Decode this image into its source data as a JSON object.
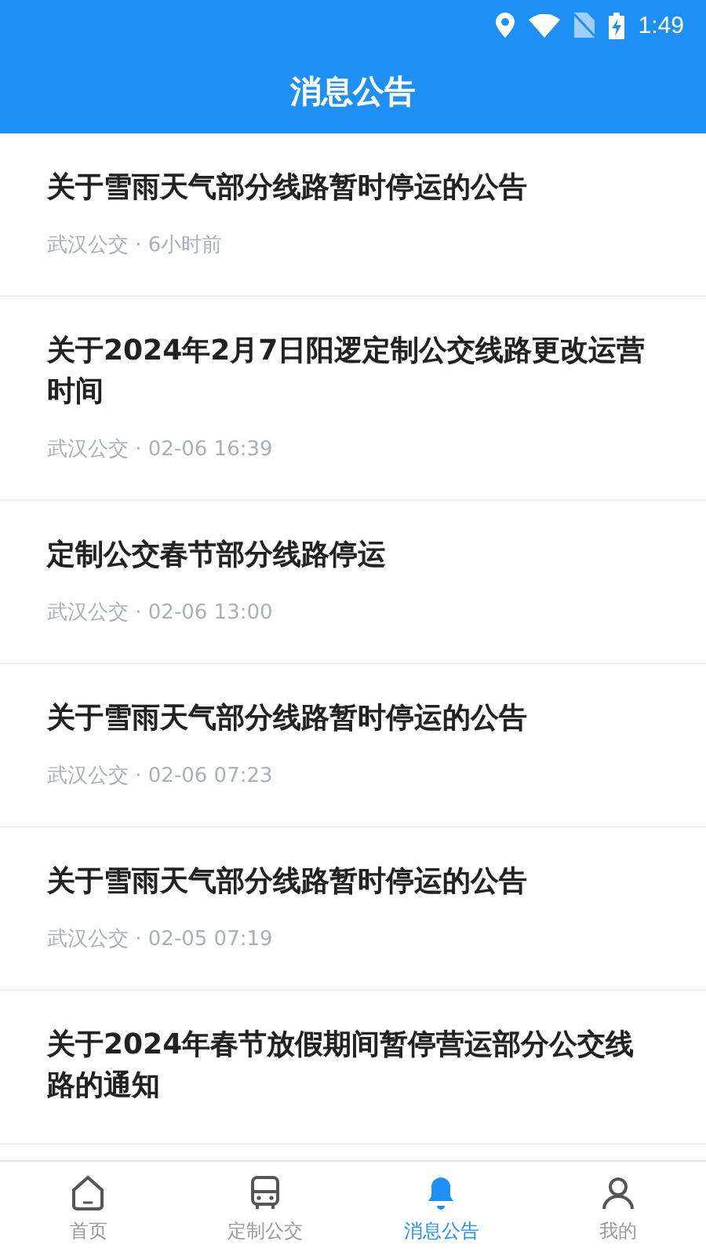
{
  "status_bar": {
    "time": "1:49"
  },
  "header": {
    "title": "消息公告"
  },
  "notices": [
    {
      "title": "关于雪雨天气部分线路暂时停运的公告",
      "meta": "武汉公交 · 6小时前"
    },
    {
      "title": "关于2024年2月7日阳逻定制公交线路更改运营时间",
      "meta": "武汉公交 · 02-06 16:39"
    },
    {
      "title": "定制公交春节部分线路停运",
      "meta": "武汉公交 · 02-06 13:00"
    },
    {
      "title": "关于雪雨天气部分线路暂时停运的公告",
      "meta": "武汉公交 · 02-06 07:23"
    },
    {
      "title": "关于雪雨天气部分线路暂时停运的公告",
      "meta": "武汉公交 · 02-05 07:19"
    },
    {
      "title": "关于2024年春节放假期间暂停营运部分公交线路的通知"
    }
  ],
  "tab_bar": [
    {
      "label": "首页",
      "kind": "home",
      "selected": false
    },
    {
      "label": "定制公交",
      "kind": "bus",
      "selected": false
    },
    {
      "label": "消息公告",
      "kind": "notice",
      "selected": true
    },
    {
      "label": "我的",
      "kind": "user",
      "selected": false
    }
  ]
}
